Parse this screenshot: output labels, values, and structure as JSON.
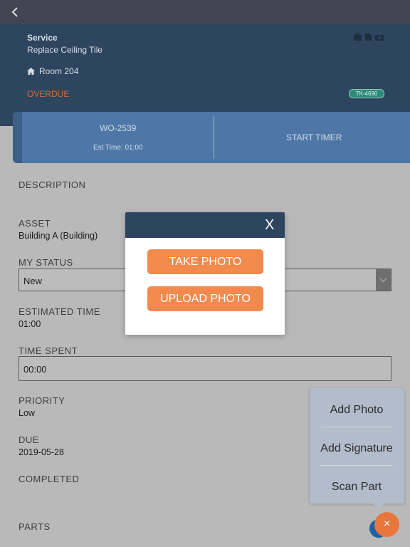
{
  "header": {
    "category": "Service",
    "title": "Replace Ceiling Tile",
    "location": "Room 204",
    "status": "OVERDUE",
    "ticket": "TK-4690",
    "icons": [
      "briefcase-icon",
      "document-icon",
      "camera-icon"
    ]
  },
  "work_order": {
    "number": "WO-2539",
    "est_time": "Est Time: 01:00",
    "start_timer_label": "START TIMER"
  },
  "fields": {
    "description_label": "DESCRIPTION",
    "asset_label": "ASSET",
    "asset_value": "Building A (Building)",
    "my_status_label": "MY STATUS",
    "my_status_value": "New",
    "estimated_time_label": "ESTIMATED TIME",
    "estimated_time_value": "01:00",
    "time_spent_label": "TIME SPENT",
    "time_spent_value": "00:00",
    "priority_label": "PRIORITY",
    "priority_value": "Low",
    "due_label": "DUE",
    "due_value": "2019-05-28",
    "completed_label": "COMPLETED",
    "parts_label": "PARTS"
  },
  "modal": {
    "close_label": "X",
    "take_photo_label": "TAKE PHOTO",
    "upload_photo_label": "UPLOAD PHOTO"
  },
  "fab_menu": {
    "items": [
      "Add Photo",
      "Add Signature",
      "Scan Part"
    ],
    "close_label": "×"
  },
  "colors": {
    "header_bg": "#2e4560",
    "card_bg": "#4e77a7",
    "overdue": "#cf6d3f",
    "accent": "#f28a4e"
  }
}
